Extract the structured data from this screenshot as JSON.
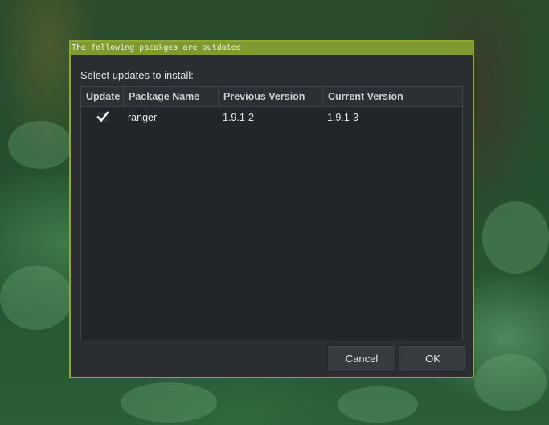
{
  "dialog": {
    "title": "The following pacakges are outdated",
    "prompt": "Select updates to install:",
    "table": {
      "columns": [
        "Update",
        "Package Name",
        "Previous Version",
        "Current Version"
      ],
      "rows": [
        {
          "update": true,
          "package": "ranger",
          "previous": "1.9.1-2",
          "current": "1.9.1-3"
        }
      ]
    },
    "buttons": {
      "cancel": "Cancel",
      "ok": "OK"
    }
  },
  "colors": {
    "accent": "#8fa838",
    "titlebar": "#7f9a2d",
    "dialog_bg": "#2b2e31",
    "table_bg": "#232629"
  },
  "icons": {
    "row_checkbox": "checkmark-icon"
  }
}
